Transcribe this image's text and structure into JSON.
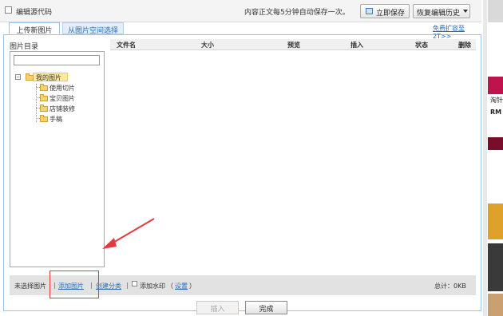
{
  "toolbar": {
    "source_code_label": "编辑源代码",
    "autosave_text": "内容正文每5分钟自动保存一次。",
    "save_now_label": "立即保存",
    "restore_history_label": "恢复编辑历史"
  },
  "tabs": {
    "upload_new": "上传新图片",
    "from_space": "从图片空间选择"
  },
  "free_expand_link": "免费扩容至2T>>",
  "directory": {
    "title": "图片目录",
    "search_value": "",
    "root": "我的图片",
    "children": [
      "使用切片",
      "宝贝图片",
      "店铺装修",
      "手稿"
    ]
  },
  "file_table": {
    "columns": [
      "文件名",
      "大小",
      "预览",
      "插入",
      "状态",
      "删除"
    ]
  },
  "bottom_bar": {
    "none_selected": "未选择图片",
    "separator": "|",
    "add_image": "添加图片",
    "create_category": "创建分类",
    "add_watermark": "添加水印",
    "paren_open": "（",
    "settings": "设置",
    "paren_close": "）",
    "total": "总计：0KB"
  },
  "buttons": {
    "insert": "插入",
    "done": "完成"
  },
  "background_page": {
    "text1": "淘针",
    "text2": "RM"
  },
  "colors": {
    "link": "#2a6db5",
    "highlight_box": "#e23b3b",
    "arrow": "#e23b3b",
    "folder": "#f7d46a"
  }
}
